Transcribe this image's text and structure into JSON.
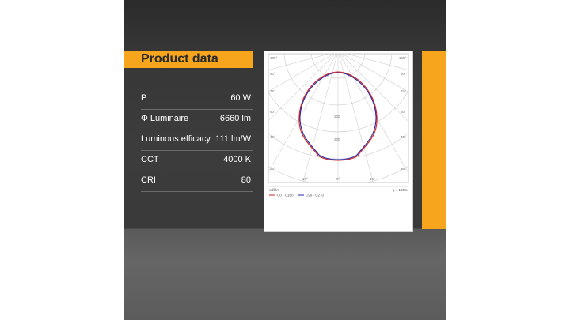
{
  "header": {
    "title": "Product data"
  },
  "specs": [
    {
      "label": "P",
      "value": "60 W"
    },
    {
      "label": "Φ Luminaire",
      "value": "6660 lm"
    },
    {
      "label": "Luminous efficacy",
      "value": "111 lm/W"
    },
    {
      "label": "CCT",
      "value": "4000 K"
    },
    {
      "label": "CRI",
      "value": "80"
    }
  ],
  "diagram": {
    "angle_labels_left": [
      "105°",
      "90°",
      "75°",
      "60°",
      "45°",
      "30°",
      "15°",
      "0°"
    ],
    "angle_labels_right": [
      "105°",
      "90°",
      "75°",
      "60°",
      "45°",
      "30°",
      "15°"
    ],
    "radial_labels": [
      "200",
      "300"
    ],
    "unit": "cd/klm",
    "efficiency": "η = 100%",
    "legend": [
      {
        "name": "C0 - C180",
        "color": "#d42020"
      },
      {
        "name": "C90 - C270",
        "color": "#2a2aa8"
      }
    ]
  },
  "colors": {
    "accent": "#f7a51c"
  }
}
